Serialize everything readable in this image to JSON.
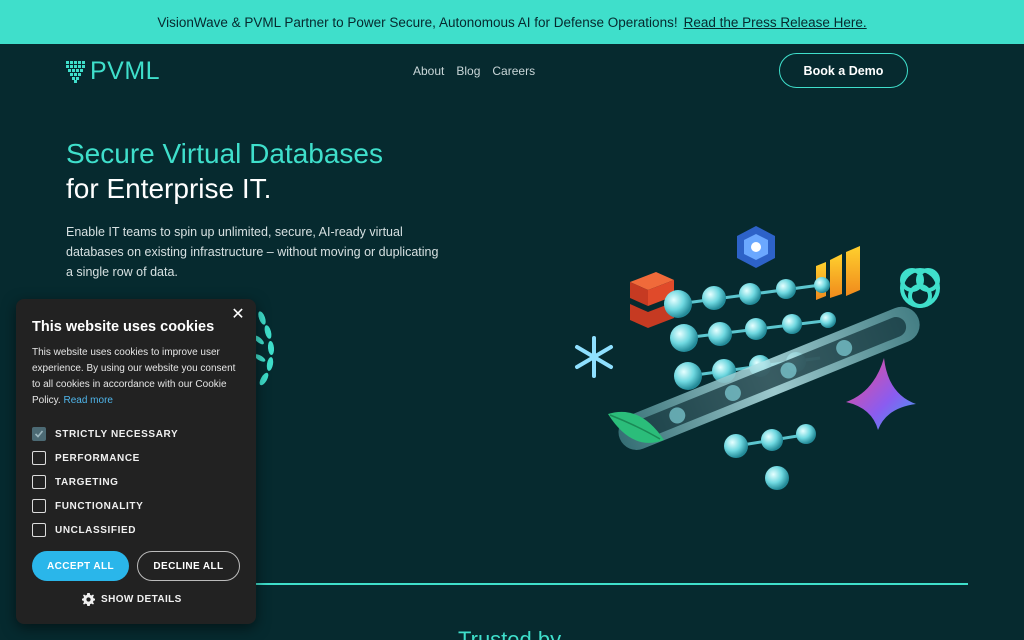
{
  "announcement": {
    "text": "VisionWave & PVML Partner to Power Secure, Autonomous AI for Defense Operations!",
    "link": "Read the Press Release Here."
  },
  "header": {
    "logo_text": "PVML",
    "nav": [
      {
        "label": "About"
      },
      {
        "label": "Blog"
      },
      {
        "label": "Careers"
      }
    ],
    "cta": "Book a Demo"
  },
  "hero": {
    "title_line1": "Secure Virtual Databases",
    "title_line2": "for Enterprise IT.",
    "description": "Enable IT teams to spin up unlimited, secure, AI-ready virtual databases on existing infrastructure – without moving or duplicating a single row of data."
  },
  "trusted_heading": "Trusted by",
  "cookie": {
    "title": "This website uses cookies",
    "body": "This website uses cookies to improve user experience. By using our website you consent to all cookies in accordance with our Cookie Policy.",
    "read_more": "Read more",
    "options": [
      {
        "label": "STRICTLY NECESSARY",
        "checked": true
      },
      {
        "label": "PERFORMANCE",
        "checked": false
      },
      {
        "label": "TARGETING",
        "checked": false
      },
      {
        "label": "FUNCTIONALITY",
        "checked": false
      },
      {
        "label": "UNCLASSIFIED",
        "checked": false
      }
    ],
    "accept": "ACCEPT ALL",
    "decline": "DECLINE ALL",
    "details": "SHOW DETAILS",
    "close_symbol": "✕"
  },
  "colors": {
    "accent": "#3fdfcb",
    "background": "#062a2f",
    "cookie_bg": "#222222",
    "accept_blue": "#2ab6ea"
  },
  "icons": [
    "pvml-logo-icon",
    "close-icon",
    "checkmark-icon",
    "gear-icon",
    "laurel-icon",
    "snowflake-icon",
    "openai-icon",
    "chart-bars-icon",
    "stack-icon",
    "hexagon-icon",
    "leaf-icon",
    "star-icon"
  ]
}
